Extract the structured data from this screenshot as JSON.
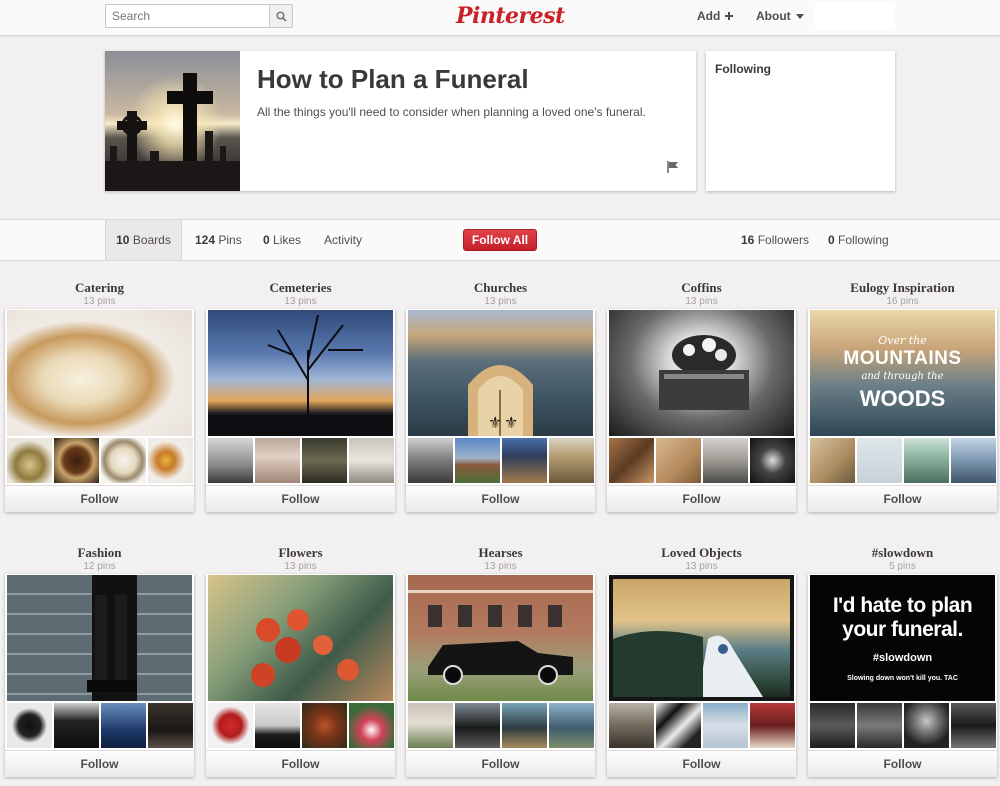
{
  "header": {
    "search_placeholder": "Search",
    "logo_text": "Pinterest",
    "add_label": "Add",
    "about_label": "About"
  },
  "profile": {
    "title": "How to Plan a Funeral",
    "description": "All the things you'll need to consider when planning a loved one's funeral.",
    "following_title": "Following"
  },
  "tabs": {
    "boards_count": "10",
    "boards_label": "Boards",
    "pins_count": "124",
    "pins_label": "Pins",
    "likes_count": "0",
    "likes_label": "Likes",
    "activity_label": "Activity",
    "follow_all_label": "Follow All",
    "followers_count": "16",
    "followers_label": "Followers",
    "following_count": "0",
    "following_label": "Following"
  },
  "boards": [
    {
      "title": "Catering",
      "count": "13 pins",
      "follow_label": "Follow"
    },
    {
      "title": "Cemeteries",
      "count": "13 pins",
      "follow_label": "Follow"
    },
    {
      "title": "Churches",
      "count": "13 pins",
      "follow_label": "Follow"
    },
    {
      "title": "Coffins",
      "count": "13 pins",
      "follow_label": "Follow"
    },
    {
      "title": "Eulogy Inspiration",
      "count": "16 pins",
      "follow_label": "Follow",
      "cover_text": [
        "Over the",
        "MOUNTAINS",
        "and through the",
        "WOODS"
      ]
    },
    {
      "title": "Fashion",
      "count": "12 pins",
      "follow_label": "Follow"
    },
    {
      "title": "Flowers",
      "count": "13 pins",
      "follow_label": "Follow"
    },
    {
      "title": "Hearses",
      "count": "13 pins",
      "follow_label": "Follow"
    },
    {
      "title": "Loved Objects",
      "count": "13 pins",
      "follow_label": "Follow"
    },
    {
      "title": "#slowdown",
      "count": "5 pins",
      "follow_label": "Follow",
      "cover_text": [
        "I'd hate to plan",
        "your funeral.",
        "#slowdown",
        "Slowing down won't kill you. TAC"
      ]
    }
  ],
  "colors": {
    "brand_red": "#cb2027",
    "page_bg": "#f2f0f0"
  }
}
